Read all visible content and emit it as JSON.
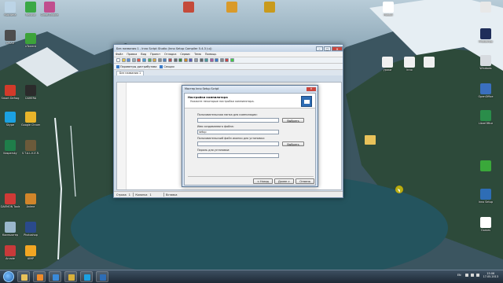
{
  "desktop": {
    "left_icons": [
      {
        "label": "Корзина",
        "color": "#bcd4e6"
      },
      {
        "label": "Recuva",
        "color": "#3aa845"
      },
      {
        "label": "Cheat Engine",
        "color": "#c04e8e"
      },
      {
        "label": "CPU-Z",
        "color": "#4d4d4d"
      },
      {
        "label": "uTorrent",
        "color": "#3da33a"
      },
      {
        "label": "Smart Defrag",
        "color": "#d23a2a"
      },
      {
        "label": "CAMERA",
        "color": "#2b2b2b"
      },
      {
        "label": "Skype",
        "color": "#1ba1e2"
      },
      {
        "label": "Google Chrome",
        "color": "#e8b42a"
      },
      {
        "label": "Kaspersky",
        "color": "#1f7e4a"
      },
      {
        "label": "S.T.A.L.K.E.R.",
        "color": "#6b5a3a"
      },
      {
        "label": "DAEMON Tools",
        "color": "#cf3a36"
      },
      {
        "label": "Anime",
        "color": "#d1852a"
      },
      {
        "label": "Компьютер",
        "color": "#9ab7cc"
      },
      {
        "label": "Photoshop",
        "color": "#2a4a8c"
      },
      {
        "label": "Arcade",
        "color": "#c83a3a"
      },
      {
        "label": "AIMP",
        "color": "#f2a623"
      }
    ],
    "top_icons": [
      {
        "label": "",
        "color": "#c44a3a"
      },
      {
        "label": "",
        "color": "#d99a2a"
      },
      {
        "label": "",
        "color": "#c99a1c"
      }
    ],
    "right_icons": [
      {
        "label": "Новый",
        "color": "#ffffff"
      },
      {
        "label": "",
        "color": "#e8e8e8"
      },
      {
        "label": "Photoshop",
        "color": "#1f2e5a"
      },
      {
        "label": "Windows",
        "color": "#d7dbe0"
      },
      {
        "label": "OpenOffice",
        "color": "#3a6fbf"
      },
      {
        "label": "LibreOffice",
        "color": "#2a8d4a"
      },
      {
        "label": "",
        "color": "#3aa83a"
      },
      {
        "label": "Inno Setup",
        "color": "#2e6db5"
      },
      {
        "label": "Games",
        "color": "#ffffff"
      }
    ],
    "mid_icons": [
      {
        "label": "уроки",
        "color": "#f0f0f0"
      },
      {
        "label": "Inno",
        "color": "#f0f0f0"
      },
      {
        "label": "",
        "color": "#f0f0f0"
      }
    ],
    "folder_icon": {
      "color": "#e8c25a"
    }
  },
  "main_window": {
    "title": "Без названия 1 - Inno Script Studio (Inno Setup Compiler 5.4.3 (u))",
    "menu": [
      "Файл",
      "Правка",
      "Вид",
      "Проект",
      "Отладка",
      "Сервис",
      "Тема",
      "Помощь"
    ],
    "toolbar2": [
      "Параметры дистрибутива",
      "Секции"
    ],
    "tab": "Без названия 1",
    "status": [
      "Строка",
      "1",
      "Колонка",
      "1",
      "Вставка"
    ]
  },
  "dialog": {
    "title": "Мастер Inno Setup Script",
    "heading": "Настройки компилятора",
    "subheading": "Укажите некоторые настройки компилятора.",
    "fields": [
      {
        "label": "Пользовательская папка для компиляции:",
        "value": "",
        "has_button": true
      },
      {
        "label": "Имя создаваемого файла:",
        "value": "setup",
        "has_button": false
      },
      {
        "label": "Пользовательский файл иконки для установки:",
        "value": "",
        "has_button": true
      },
      {
        "label": "Пароль для установки:",
        "value": "",
        "has_button": false
      }
    ],
    "browse_label": "Выбрать",
    "back_label": "< Назад",
    "next_label": "Далее >",
    "cancel_label": "Отмена"
  },
  "taskbar": {
    "lang": "EN",
    "time": "15:06",
    "date": "17.05.2013"
  }
}
